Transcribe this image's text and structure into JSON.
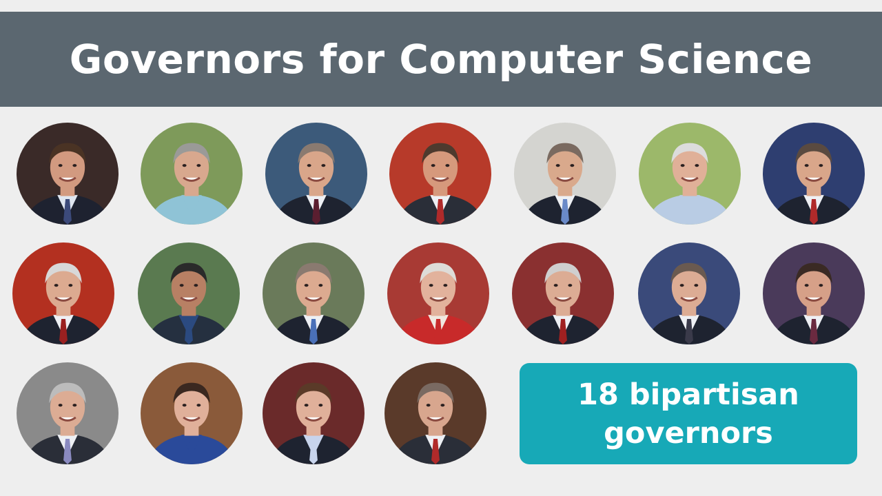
{
  "title": "Governors for Computer Science",
  "badge": {
    "line1": "18 bipartisan",
    "line2": "governors"
  },
  "colors": {
    "title_bar": "#5b6770",
    "badge": "#17a9b7",
    "background": "#eeeeee"
  },
  "portraits": [
    {
      "bg": "#3a2a28",
      "skin": "#d29a80",
      "hair": "#4a3324",
      "suit": "#1e2230",
      "shirt": "#dfe6f0",
      "tie": "#3c4a7a"
    },
    {
      "bg": "#7e9a5a",
      "skin": "#d8a88e",
      "hair": "#9a9a98",
      "suit": "#8fc3d6",
      "shirt": "#8fc3d6",
      "tie": "#8fc3d6"
    },
    {
      "bg": "#3c5a7a",
      "skin": "#d9a68a",
      "hair": "#8a7a70",
      "suit": "#1e2330",
      "shirt": "#eef0f4",
      "tie": "#5a1e30"
    },
    {
      "bg": "#b73a2a",
      "skin": "#d6997c",
      "hair": "#4e3a2e",
      "suit": "#2a2e38",
      "shirt": "#eef0f4",
      "tie": "#b02a2a"
    },
    {
      "bg": "#d4d4d0",
      "skin": "#d9a98c",
      "hair": "#7a6a60",
      "suit": "#1e2330",
      "shirt": "#eef0f4",
      "tie": "#6a8ac8"
    },
    {
      "bg": "#9cb86a",
      "skin": "#e0b098",
      "hair": "#dcdcdc",
      "suit": "#b9cce4",
      "shirt": "#b9cce4",
      "tie": "#b9cce4"
    },
    {
      "bg": "#2e3e70",
      "skin": "#d9a68a",
      "hair": "#5a4a40",
      "suit": "#1e2330",
      "shirt": "#eef0f4",
      "tie": "#b02a2a"
    },
    {
      "bg": "#b33020",
      "skin": "#dcaa90",
      "hair": "#d8d8d8",
      "suit": "#1e2330",
      "shirt": "#eef0f4",
      "tie": "#9a2020"
    },
    {
      "bg": "#5a7a50",
      "skin": "#b88064",
      "hair": "#2a2a2a",
      "suit": "#253040",
      "shirt": "#2b4a80",
      "tie": "#2b4a80"
    },
    {
      "bg": "#6a7a5a",
      "skin": "#dcaa90",
      "hair": "#8a7a70",
      "suit": "#1e2330",
      "shirt": "#eef0f4",
      "tie": "#4a70b8"
    },
    {
      "bg": "#a83a34",
      "skin": "#e2b29c",
      "hair": "#dedcd8",
      "suit": "#c82a2a",
      "shirt": "#f0e8e0",
      "tie": "#c82a2a"
    },
    {
      "bg": "#8a3030",
      "skin": "#dcac94",
      "hair": "#cfcfcf",
      "suit": "#1e2330",
      "shirt": "#eef0f4",
      "tie": "#a02020"
    },
    {
      "bg": "#3a4a7a",
      "skin": "#dcac94",
      "hair": "#6a5a50",
      "suit": "#1e2330",
      "shirt": "#eef0f4",
      "tie": "#3a3a4a"
    },
    {
      "bg": "#4a3a5a",
      "skin": "#d6a088",
      "hair": "#3a2a24",
      "suit": "#1e2330",
      "shirt": "#eef0f4",
      "tie": "#6a2a40"
    },
    {
      "bg": "#8a8a8a",
      "skin": "#dcac94",
      "hair": "#bcbcbc",
      "suit": "#2a2e38",
      "shirt": "#eef0f4",
      "tie": "#8a8ac0"
    },
    {
      "bg": "#8a5a3a",
      "skin": "#e0b09a",
      "hair": "#3a2820",
      "suit": "#2a4a9a",
      "shirt": "#2a4a9a",
      "tie": "#2a4a9a"
    },
    {
      "bg": "#6a2a2a",
      "skin": "#e0b09a",
      "hair": "#5a3a28",
      "suit": "#1e2330",
      "shirt": "#c8d4ec",
      "tie": "#c8d4ec"
    },
    {
      "bg": "#5a3a2a",
      "skin": "#d8a68e",
      "hair": "#7a6a62",
      "suit": "#2a2e38",
      "shirt": "#eef0f4",
      "tie": "#b02a2a"
    }
  ]
}
